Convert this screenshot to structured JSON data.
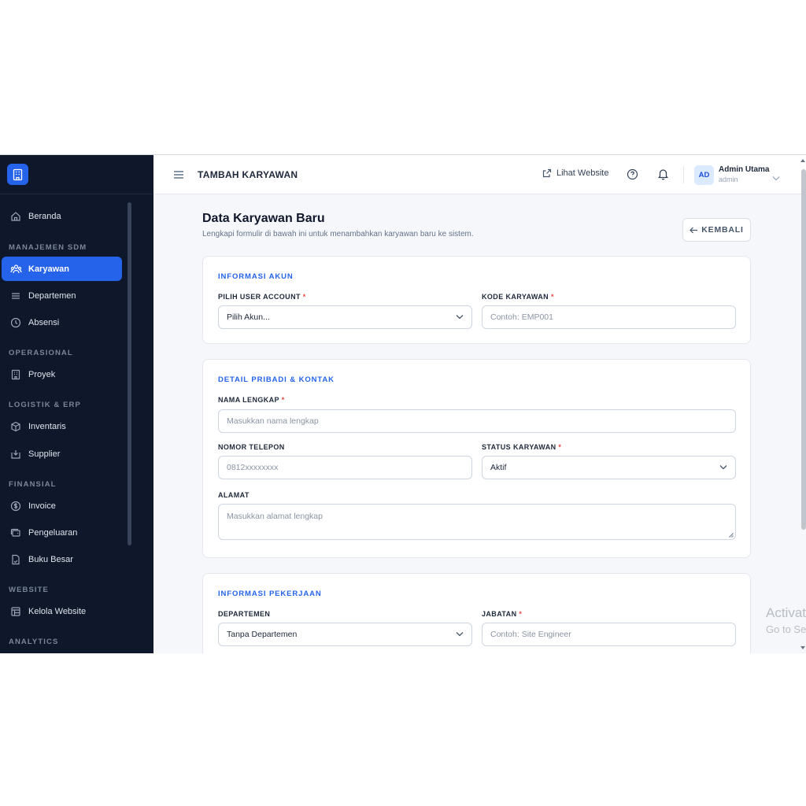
{
  "sidebar": {
    "items": [
      {
        "label": "Beranda",
        "icon": "home-icon"
      },
      {
        "label": "Karyawan",
        "icon": "users-icon",
        "active": true
      },
      {
        "label": "Departemen",
        "icon": "list-icon"
      },
      {
        "label": "Absensi",
        "icon": "clock-icon"
      },
      {
        "label": "Proyek",
        "icon": "building-icon"
      },
      {
        "label": "Inventaris",
        "icon": "box-icon"
      },
      {
        "label": "Supplier",
        "icon": "inbox-icon"
      },
      {
        "label": "Invoice",
        "icon": "dollar-icon"
      },
      {
        "label": "Pengeluaran",
        "icon": "wallet-icon"
      },
      {
        "label": "Buku Besar",
        "icon": "book-icon"
      },
      {
        "label": "Kelola Website",
        "icon": "layout-icon"
      }
    ],
    "sections": [
      "MANAJEMEN SDM",
      "OPERASIONAL",
      "LOGISTIK & ERP",
      "FINANSIAL",
      "WEBSITE",
      "ANALYTICS"
    ]
  },
  "header": {
    "title": "TAMBAH KARYAWAN",
    "view_site": "Lihat Website",
    "user": {
      "initials": "AD",
      "name": "Admin Utama",
      "role": "admin"
    }
  },
  "page": {
    "title": "Data Karyawan Baru",
    "subtitle": "Lengkapi formulir di bawah ini untuk menambahkan karyawan baru ke sistem.",
    "back_label": "KEMBALI"
  },
  "account": {
    "title": "INFORMASI AKUN",
    "user_label": "PILIH USER ACCOUNT",
    "user_value": "Pilih Akun...",
    "code_label": "KODE KARYAWAN",
    "code_placeholder": "Contoh: EMP001"
  },
  "personal": {
    "title": "DETAIL PRIBADI & KONTAK",
    "name_label": "NAMA LENGKAP",
    "name_placeholder": "Masukkan nama lengkap",
    "phone_label": "NOMOR TELEPON",
    "phone_placeholder": "0812xxxxxxxx",
    "status_label": "STATUS KARYAWAN",
    "status_value": "Aktif",
    "address_label": "ALAMAT",
    "address_placeholder": "Masukkan alamat lengkap"
  },
  "job": {
    "title": "INFORMASI PEKERJAAN",
    "dept_label": "DEPARTEMEN",
    "dept_value": "Tanpa Departemen",
    "position_label": "JABATAN",
    "position_placeholder": "Contoh: Site Engineer"
  },
  "required_mark": "*",
  "watermark": {
    "line1": "Activat",
    "line2": "Go to Se"
  },
  "colors": {
    "sidebar_bg": "#0f172a",
    "accent": "#2563eb",
    "required": "#ef4444"
  }
}
